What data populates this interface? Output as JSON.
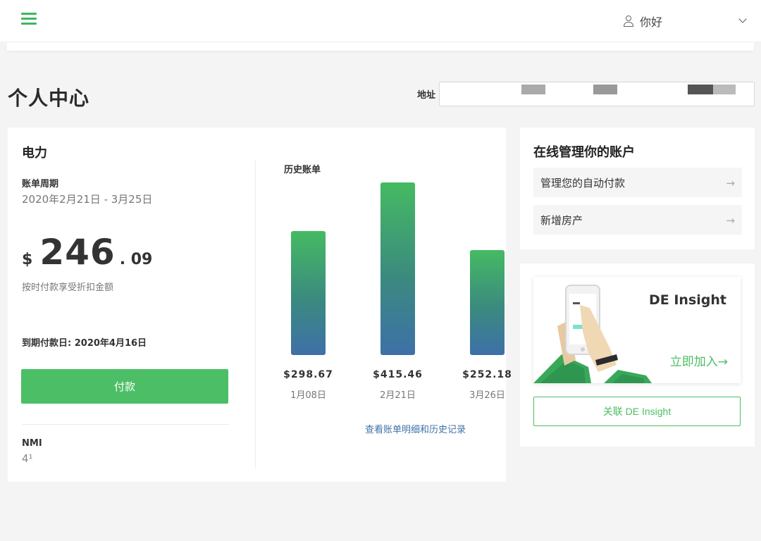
{
  "header": {
    "greeting": "你好"
  },
  "page": {
    "title": "个人中心",
    "address_label": "地址",
    "address_value": ""
  },
  "bill": {
    "utility": "电力",
    "cycle_label": "账单周期",
    "cycle_value": "2020年2月21日 - 3月25日",
    "currency": "$",
    "amount_major": "246",
    "amount_cents": ". 09",
    "discount_note": "按时付款享受折扣金额",
    "due_date": "到期付款日: 2020年4月16日",
    "pay_button": "付款",
    "nmi_label": "NMI",
    "nmi_value": "4¹"
  },
  "history": {
    "title": "历史账单",
    "link": "查看账单明细和历史记录"
  },
  "chart_data": {
    "type": "bar",
    "title": "历史账单",
    "categories": [
      "1月08日",
      "2月21日",
      "3月26日"
    ],
    "values": [
      298.67,
      415.46,
      252.18
    ],
    "value_labels": [
      "$298.67",
      "$415.46",
      "$252.18"
    ],
    "xlabel": "",
    "ylabel": "",
    "grid": false
  },
  "manage": {
    "title": "在线管理你的账户",
    "items": [
      {
        "label": "管理您的自动付款",
        "arrow": "→"
      },
      {
        "label": "新增房产",
        "arrow": "→"
      }
    ]
  },
  "insight": {
    "title": "DE Insight",
    "join": "立即加入→",
    "link_button": "关联 DE Insight"
  },
  "colors": {
    "accent": "#4cbe65",
    "link": "#3f73a8",
    "bar_top": "#45ba62",
    "bar_bottom": "#3e70a8"
  },
  "icons": {
    "menu": "hamburger-menu-icon",
    "user": "user-icon",
    "dropdown": "chevron-down-icon",
    "arrow": "arrow-right-icon"
  }
}
